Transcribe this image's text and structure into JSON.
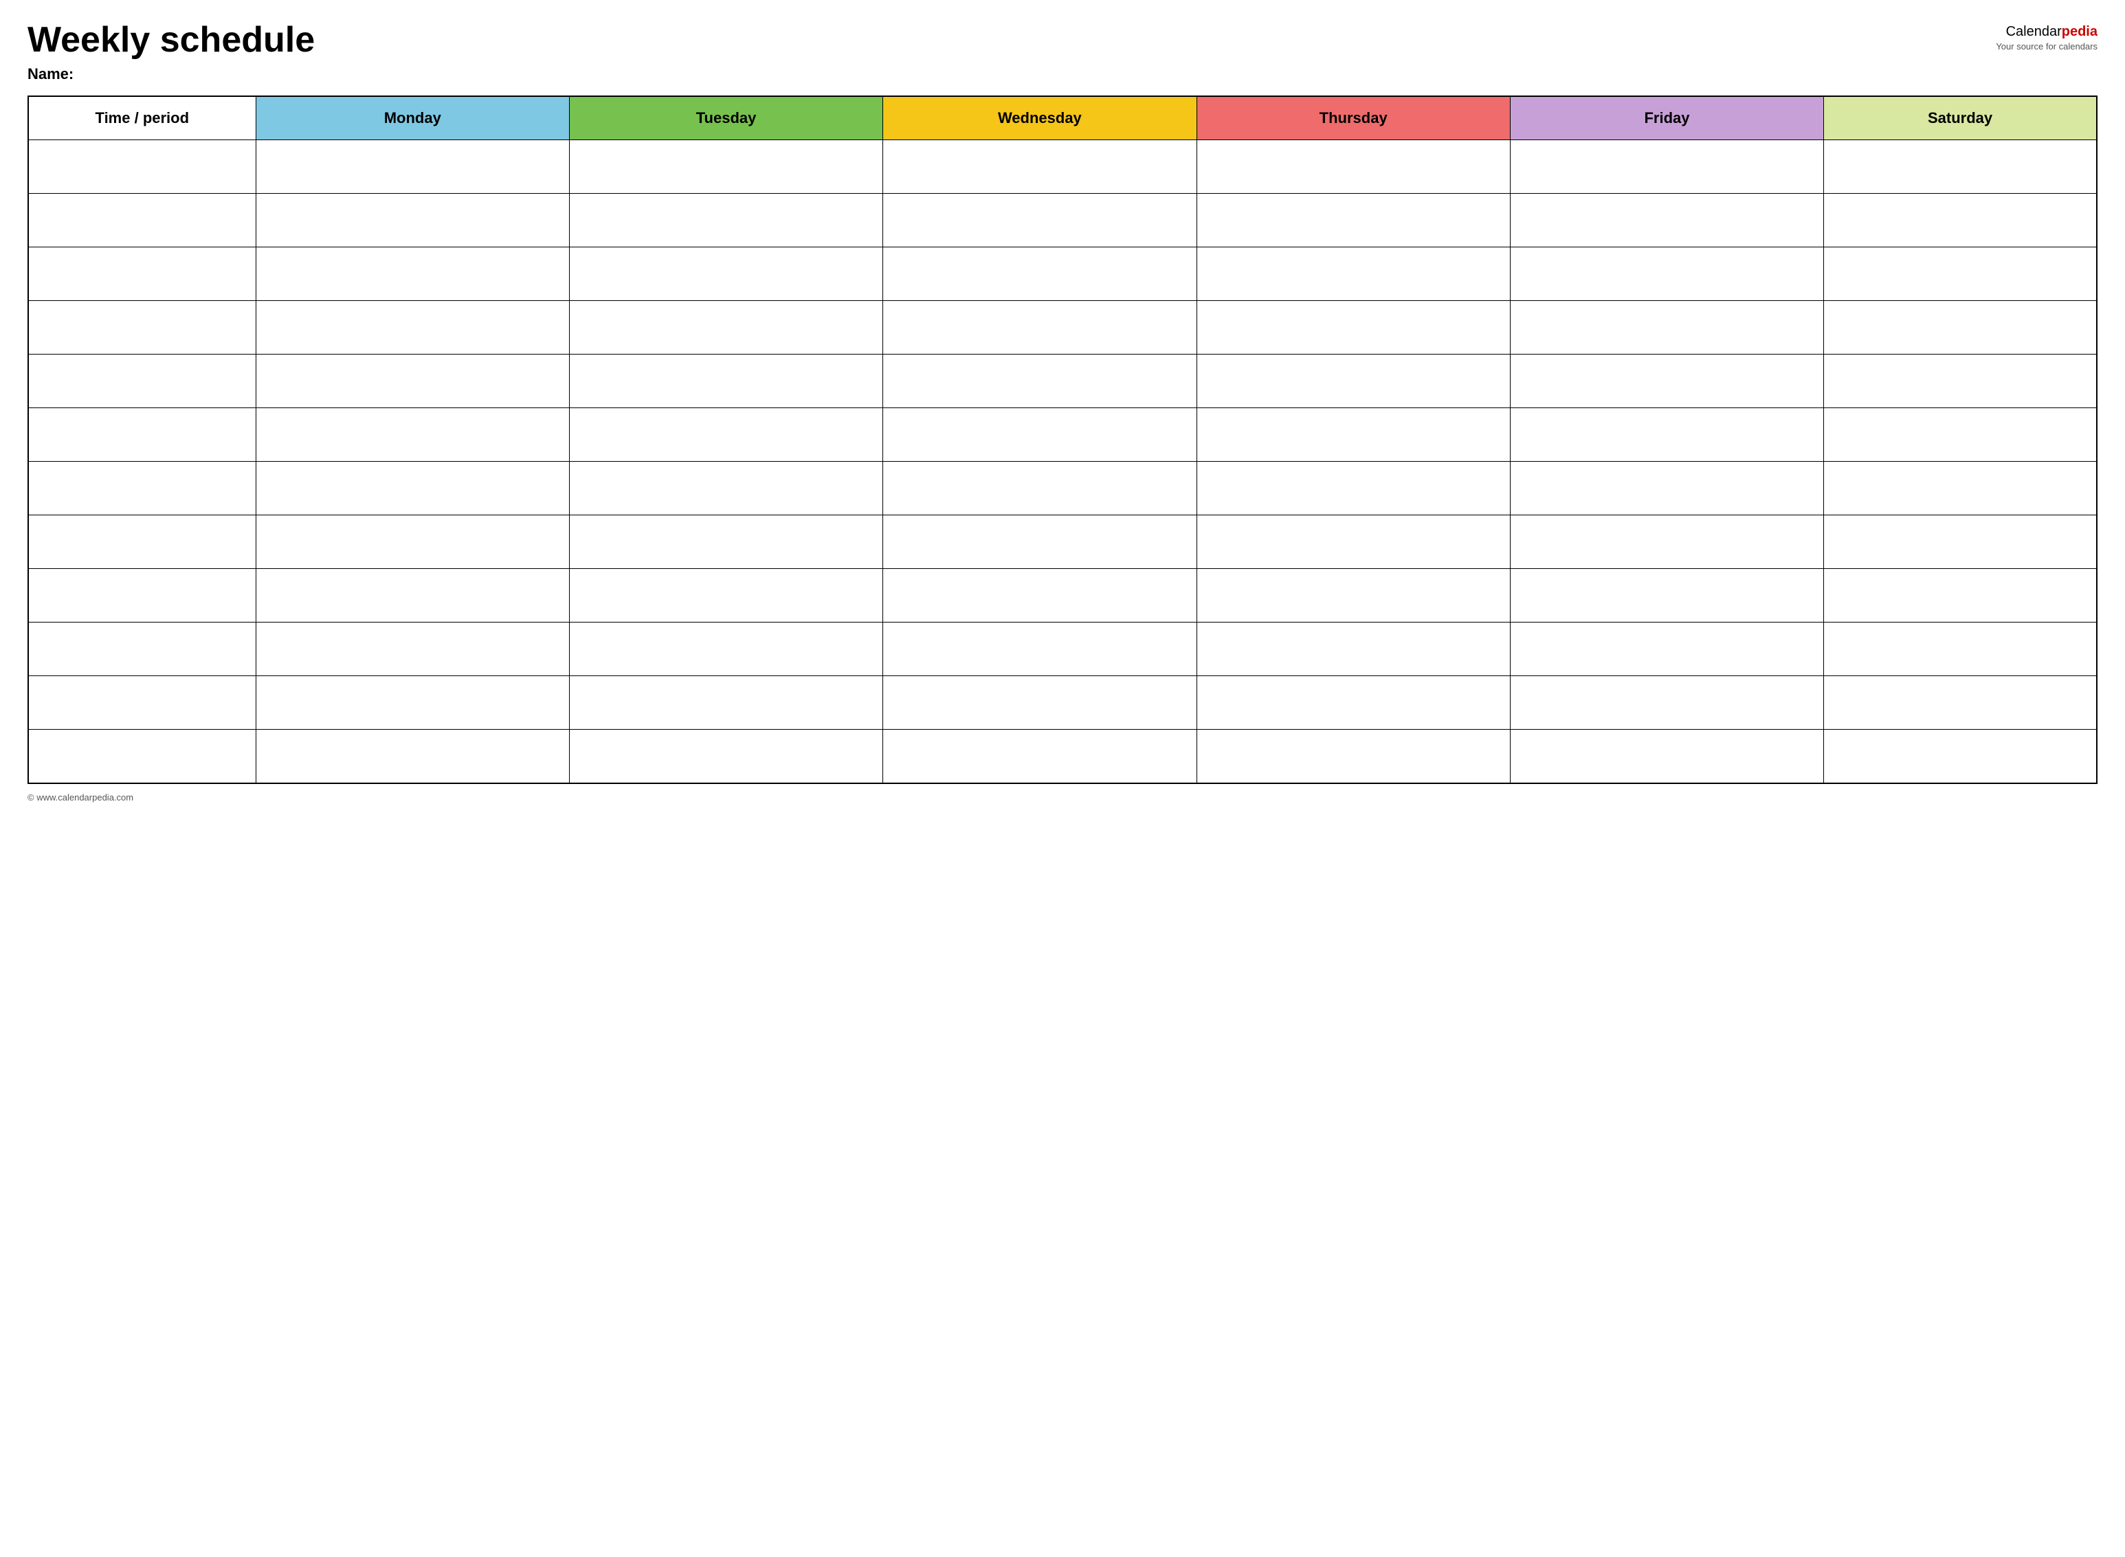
{
  "header": {
    "title": "Weekly schedule",
    "name_label": "Name:",
    "logo_calendar": "Calendar",
    "logo_pedia": "pedia",
    "logo_tagline": "Your source for calendars"
  },
  "table": {
    "columns": [
      {
        "id": "time",
        "label": "Time / period",
        "color": "#ffffff",
        "text_color": "#000000"
      },
      {
        "id": "monday",
        "label": "Monday",
        "color": "#7ec8e3",
        "text_color": "#000000"
      },
      {
        "id": "tuesday",
        "label": "Tuesday",
        "color": "#77c14e",
        "text_color": "#000000"
      },
      {
        "id": "wednesday",
        "label": "Wednesday",
        "color": "#f5c518",
        "text_color": "#000000"
      },
      {
        "id": "thursday",
        "label": "Thursday",
        "color": "#f06b6b",
        "text_color": "#000000"
      },
      {
        "id": "friday",
        "label": "Friday",
        "color": "#c8a0d8",
        "text_color": "#000000"
      },
      {
        "id": "saturday",
        "label": "Saturday",
        "color": "#d8e8a0",
        "text_color": "#000000"
      }
    ],
    "row_count": 12
  },
  "footer": {
    "url": "© www.calendarpedia.com"
  }
}
